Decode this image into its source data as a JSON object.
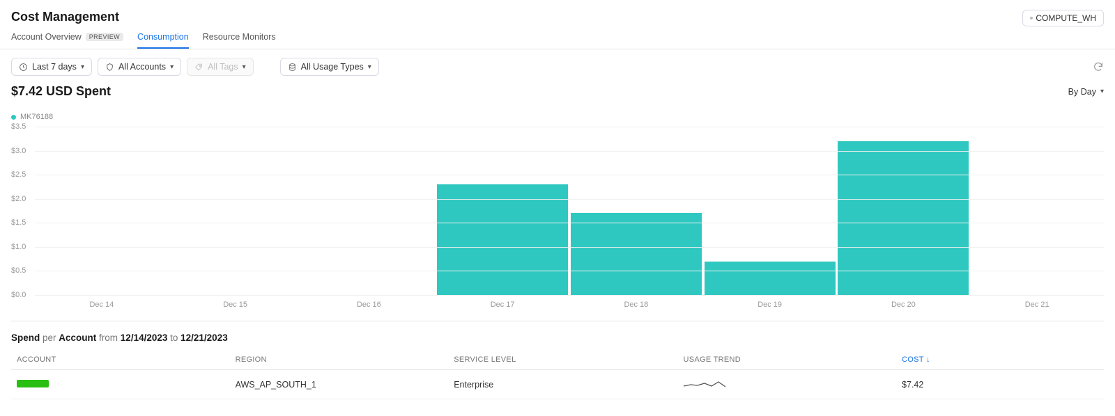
{
  "header": {
    "page_title": "Cost Management",
    "warehouse_button": "COMPUTE_WH"
  },
  "tabs": {
    "overview": "Account Overview",
    "overview_badge": "PREVIEW",
    "consumption": "Consumption",
    "monitors": "Resource Monitors"
  },
  "filters": {
    "range": "Last 7 days",
    "accounts": "All Accounts",
    "tags": "All Tags",
    "usage_types": "All Usage Types"
  },
  "summary": {
    "spent": "$7.42 USD Spent",
    "by_day": "By Day"
  },
  "legend": {
    "series_name": "MK76188",
    "series_color": "#2fc8c0"
  },
  "chart_data": {
    "type": "bar",
    "title": "",
    "xlabel": "",
    "ylabel": "",
    "ylim": [
      0,
      3.5
    ],
    "y_ticks": [
      "$0.0",
      "$0.5",
      "$1.0",
      "$1.5",
      "$2.0",
      "$2.5",
      "$3.0",
      "$3.5"
    ],
    "categories": [
      "Dec 14",
      "Dec 15",
      "Dec 16",
      "Dec 17",
      "Dec 18",
      "Dec 19",
      "Dec 20",
      "Dec 21"
    ],
    "series": [
      {
        "name": "MK76188",
        "color": "#2fc8c0",
        "values": [
          0,
          0,
          0,
          2.3,
          1.7,
          0.7,
          3.2,
          0
        ]
      }
    ]
  },
  "section": {
    "prefix": "Spend",
    "per": " per ",
    "entity": "Account",
    "from": " from ",
    "date_from": "12/14/2023",
    "to": " to ",
    "date_to": "12/21/2023"
  },
  "table": {
    "headers": {
      "account": "ACCOUNT",
      "region": "REGION",
      "service_level": "SERVICE LEVEL",
      "usage_trend": "USAGE TREND",
      "cost": "COST"
    },
    "rows": [
      {
        "region": "AWS_AP_SOUTH_1",
        "service_level": "Enterprise",
        "cost": "$7.42"
      }
    ]
  }
}
